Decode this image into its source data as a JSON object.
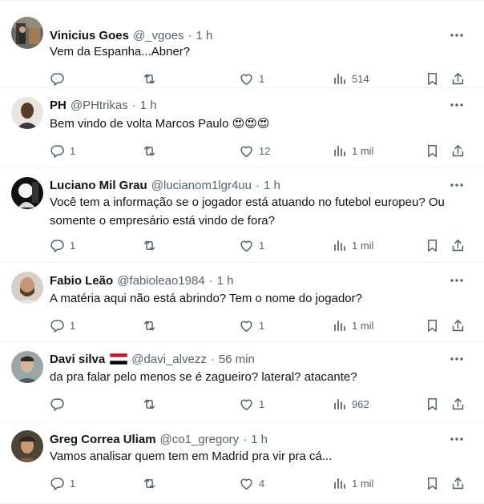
{
  "tweets": [
    {
      "name": "Vinicius Goes",
      "handle": "@_vgoes",
      "time": "1 h",
      "text": "Vem da Espanha...Abner?",
      "has_flag": false,
      "replies": "",
      "retweets": "",
      "likes": "1",
      "views": "514",
      "avatar": "avatar-photo-doorway"
    },
    {
      "name": "PH",
      "handle": "@PHtrikas",
      "time": "1 h",
      "text": "Bem vindo de volta Marcos Paulo 😍😍😍",
      "has_flag": false,
      "replies": "1",
      "retweets": "",
      "likes": "12",
      "views": "1 mil",
      "avatar": "avatar-photo-man-shaved"
    },
    {
      "name": "Luciano Mil Grau",
      "handle": "@lucianom1lgr4uu",
      "time": "1 h",
      "text": "Você tem a informação se o jogador está atuando no futebol europeu? Ou somente o empresário está vindo de fora?",
      "has_flag": false,
      "replies": "1",
      "retweets": "",
      "likes": "1",
      "views": "1 mil",
      "avatar": "avatar-photo-black-white"
    },
    {
      "name": "Fabio Leão",
      "handle": "@fabioleao1984",
      "time": "1 h",
      "text": "A matéria aqui não está abrindo? Tem o nome do jogador?",
      "has_flag": false,
      "replies": "1",
      "retweets": "",
      "likes": "1",
      "views": "1 mil",
      "avatar": "avatar-photo-bearded"
    },
    {
      "name": "Davi silva",
      "handle": "@davi_alvezz",
      "time": "56 min",
      "text": "da pra falar pelo menos se é zagueiro? lateral? atacante?",
      "has_flag": true,
      "replies": "",
      "retweets": "",
      "likes": "1",
      "views": "962",
      "avatar": "avatar-photo-young-man"
    },
    {
      "name": "Greg Correa Uliam",
      "handle": "@co1_gregory",
      "time": "1 h",
      "text": "Vamos analisar quem tem em Madrid pra vir pra cá...",
      "has_flag": false,
      "replies": "1",
      "retweets": "",
      "likes": "4",
      "views": "1 mil",
      "avatar": "avatar-photo-cap"
    }
  ],
  "icons": {
    "more": "more-horizontal-icon",
    "reply": "reply-icon",
    "retweet": "retweet-icon",
    "like": "heart-icon",
    "views": "views-chart-icon",
    "bookmark": "bookmark-icon",
    "share": "share-icon"
  },
  "colors": {
    "secondary_text": "#536471",
    "primary_text": "#0f1419",
    "divider": "#eff3f4",
    "flag_red": "#ce1126",
    "flag_black": "#000000"
  }
}
